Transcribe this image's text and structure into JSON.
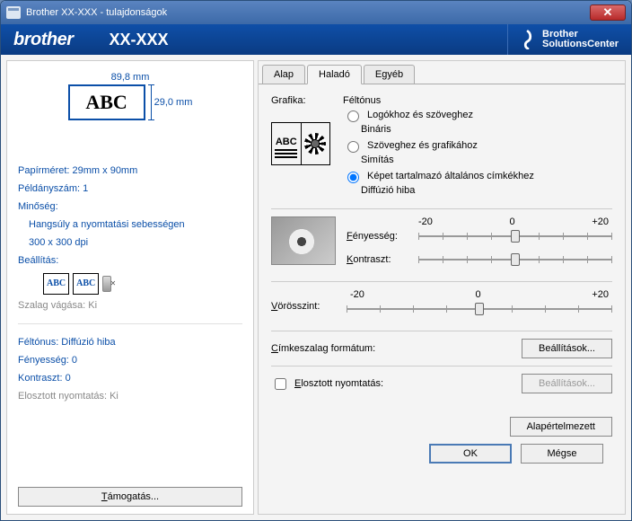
{
  "window": {
    "title": "Brother  XX-XXX   - tulajdonságok",
    "close_glyph": "✕"
  },
  "brand": {
    "logo": "brother",
    "model": "XX-XXX",
    "sc_line1": "Brother",
    "sc_line2": "SolutionsCenter"
  },
  "left": {
    "width_label": "89,8 mm",
    "height_label": "29,0 mm",
    "abc": "ABC",
    "paper_size": "Papírméret: 29mm x 90mm",
    "copies": "Példányszám: 1",
    "quality_h": "Minőség:",
    "quality_v1": "Hangsúly a nyomtatási sebességen",
    "quality_v2": "300 x 300 dpi",
    "setting_h": "Beállítás:",
    "tape_cut": "Szalag vágása: Ki",
    "halftone": "Féltónus: Diffúzió hiba",
    "brightness": "Fényesség:  0",
    "contrast": "Kontraszt:  0",
    "distributed": "Elosztott nyomtatás: Ki",
    "support_btn": "Támogatás..."
  },
  "tabs": {
    "t0": "Alap",
    "t1": "Haladó",
    "t2": "Egyéb"
  },
  "right": {
    "grafika": "Grafika:",
    "halftone_h": "Féltónus",
    "r1": "Logókhoz és szöveghez",
    "r1s": "Bináris",
    "r2": "Szöveghez és grafikához",
    "r2s": "Simítás",
    "r3": "Képet tartalmazó általános címkékhez",
    "r3s": "Diffúzió hiba",
    "scale_neg": "-20",
    "scale_zero": "0",
    "scale_pos": "+20",
    "brightness_l": "Fényesség:",
    "contrast_l": "Kontraszt:",
    "red_l": "Vörösszint:",
    "tape_format": "Címkeszalag formátum:",
    "settings_btn": "Beállítások...",
    "distributed_l": "Elosztott nyomtatás:",
    "settings_btn2": "Beállítások...",
    "defaults_btn": "Alapértelmezett"
  },
  "footer": {
    "ok": "OK",
    "cancel": "Mégse"
  },
  "accel": {
    "E": "E",
    "V": "V",
    "C": "C",
    "T": "T"
  }
}
